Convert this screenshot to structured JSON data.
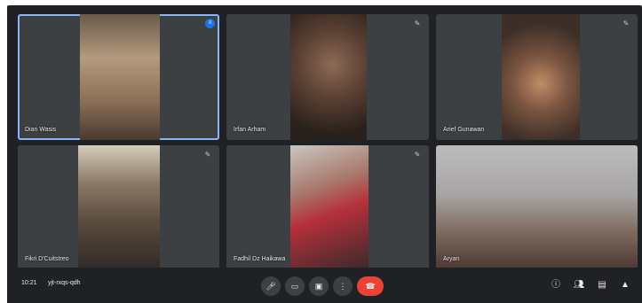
{
  "meeting": {
    "time": "10:21",
    "code": "yjt-rxqs-qdh"
  },
  "participants": [
    {
      "name": "Dian Wasis",
      "active": true
    },
    {
      "name": "Irfan Arham",
      "active": false
    },
    {
      "name": "Arief Gunawan",
      "active": false
    },
    {
      "name": "Fikri D'Cuitstreo",
      "active": false
    },
    {
      "name": "Fadhil Dz Haikawa",
      "active": false
    },
    {
      "name": "Aryan",
      "active": false
    }
  ],
  "icons": {
    "mic": "microphone-icon",
    "camera": "camera-icon",
    "captions": "captions-icon",
    "present": "present-icon",
    "more": "more-icon",
    "end": "end-call-icon",
    "info": "info-icon",
    "people": "people-icon",
    "chat": "chat-icon",
    "activities": "activities-icon"
  },
  "colors": {
    "background": "#202124",
    "tile": "#3c4043",
    "active_outline": "#8ab4f8",
    "end_call": "#ea4335"
  }
}
